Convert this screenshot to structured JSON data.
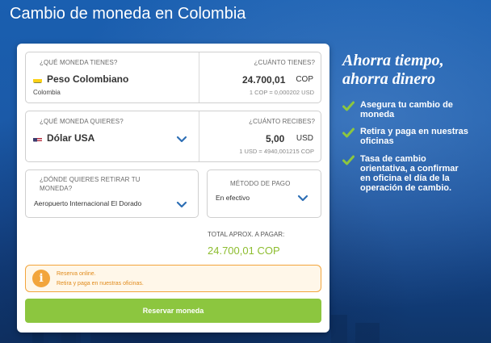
{
  "page": {
    "title": "Cambio de moneda en Colombia"
  },
  "form": {
    "from": {
      "label": "¿QUÉ MONEDA TIENES?",
      "currency": "Peso Colombiano",
      "country": "Colombia",
      "amount_label": "¿CUÁNTO TIENES?",
      "amount": "24.700,01",
      "code": "COP",
      "rate": "1 COP = 0,000202 USD"
    },
    "to": {
      "label": "¿QUÉ MONEDA QUIERES?",
      "currency": "Dólar USA",
      "amount_label": "¿CUÁNTO RECIBES?",
      "amount": "5,00",
      "code": "USD",
      "rate": "1 USD = 4940,001215 COP"
    },
    "pickup": {
      "label_line1": "¿DÓNDE QUIERES RETIRAR TU",
      "label_line2": "MONEDA?",
      "value": "Aeropuerto Internacional El Dorado"
    },
    "payment": {
      "label": "MÉTODO DE PAGO",
      "value": "En efectivo"
    },
    "total": {
      "label": "TOTAL APROX. A PAGAR:",
      "value": "24.700,01 COP"
    },
    "notice": {
      "line1": "Reserva online.",
      "line2": "Retira y paga en nuestras oficinas."
    },
    "reserve_label": "Reservar moneda"
  },
  "promo": {
    "title_line1": "Ahorra tiempo,",
    "title_line2": "ahorra dinero",
    "benefits": [
      {
        "line1": "Asegura tu cambio de",
        "line2": "moneda"
      },
      {
        "line1": "Retira y paga en nuestras",
        "line2": "oficinas"
      },
      {
        "line1": "Tasa de cambio",
        "line2": "orientativa, a confirmar",
        "line3": "en oficina el día de la",
        "line4": "operación de cambio."
      }
    ]
  },
  "colors": {
    "accent_green": "#8cc63f",
    "chevron_blue": "#2e6fb5",
    "notice_orange": "#f2a53c"
  }
}
